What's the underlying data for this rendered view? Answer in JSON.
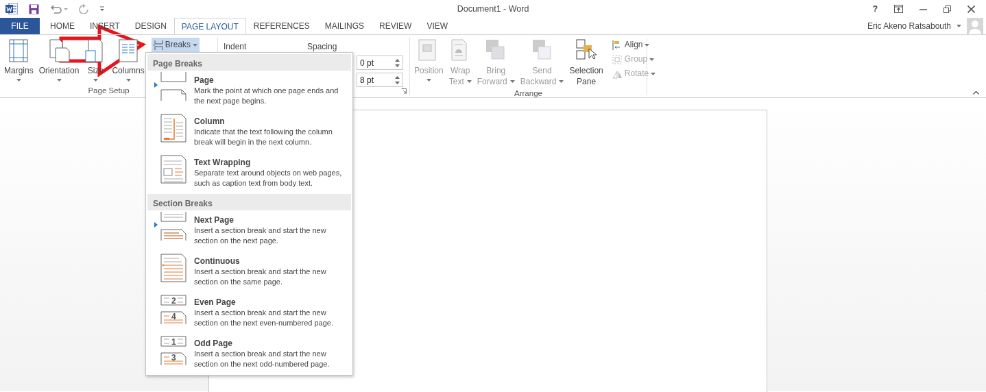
{
  "title_bar": {
    "title": "Document1 - Word",
    "help": "?"
  },
  "tabs": [
    {
      "label": "FILE",
      "kind": "file",
      "selected": false
    },
    {
      "label": "HOME",
      "kind": "tab",
      "selected": false
    },
    {
      "label": "INSERT",
      "kind": "tab",
      "selected": false
    },
    {
      "label": "DESIGN",
      "kind": "tab",
      "selected": false
    },
    {
      "label": "PAGE LAYOUT",
      "kind": "tab",
      "selected": true
    },
    {
      "label": "REFERENCES",
      "kind": "tab",
      "selected": false
    },
    {
      "label": "MAILINGS",
      "kind": "tab",
      "selected": false
    },
    {
      "label": "REVIEW",
      "kind": "tab",
      "selected": false
    },
    {
      "label": "VIEW",
      "kind": "tab",
      "selected": false
    }
  ],
  "user": {
    "name": "Eric Akeno Ratsabouth"
  },
  "page_setup": {
    "label": "Page Setup",
    "buttons": [
      {
        "label": "Margins",
        "kind": "margins"
      },
      {
        "label": "Orientation",
        "kind": "orientation"
      },
      {
        "label": "Size",
        "kind": "size"
      },
      {
        "label": "Columns",
        "kind": "columns"
      }
    ],
    "breaks": {
      "label": "Breaks",
      "expanded": true
    }
  },
  "paragraph": {
    "indent_label": "Indent",
    "spacing_label": "Spacing",
    "spacing_fields": [
      {
        "value": "0 pt"
      },
      {
        "value": "8 pt"
      }
    ]
  },
  "arrange": {
    "label": "Arrange",
    "large_buttons": [
      {
        "lines": [
          "Position"
        ],
        "kind": "position",
        "disabled": true,
        "dropdown": true
      },
      {
        "lines": [
          "Wrap",
          "Text"
        ],
        "kind": "wrap",
        "disabled": true,
        "dropdown": true
      },
      {
        "lines": [
          "Bring",
          "Forward"
        ],
        "kind": "bring",
        "disabled": true,
        "dropdown": true
      },
      {
        "lines": [
          "Send",
          "Backward"
        ],
        "kind": "send",
        "disabled": true,
        "dropdown": true
      },
      {
        "lines": [
          "Selection",
          "Pane"
        ],
        "kind": "selection",
        "disabled": false,
        "dropdown": false
      }
    ],
    "small_buttons": [
      {
        "label": "Align",
        "kind": "align",
        "disabled": false
      },
      {
        "label": "Group",
        "kind": "group",
        "disabled": true
      },
      {
        "label": "Rotate",
        "kind": "rotate",
        "disabled": true
      }
    ]
  },
  "breaks_menu": {
    "sections": [
      {
        "heading": "Page Breaks",
        "items": [
          {
            "title": "Page",
            "description": "Mark the point at which one page ends and the next page begins.",
            "kind": "page"
          },
          {
            "title": "Column",
            "description": "Indicate that the text following the column break will begin in the next column.",
            "kind": "column"
          },
          {
            "title": "Text Wrapping",
            "description": "Separate text around objects on web pages, such as caption text from body text.",
            "kind": "wrapping"
          }
        ]
      },
      {
        "heading": "Section Breaks",
        "items": [
          {
            "title": "Next Page",
            "description": "Insert a section break and start the new section on the next page.",
            "kind": "next"
          },
          {
            "title": "Continuous",
            "description": "Insert a section break and start the new section on the same page.",
            "kind": "continuous"
          },
          {
            "title": "Even Page",
            "description": "Insert a section break and start the new section on the next even-numbered page.",
            "kind": "numbered",
            "page_numbers": [
              "2",
              "4"
            ]
          },
          {
            "title": "Odd Page",
            "description": "Insert a section break and start the new section on the next odd-numbered page.",
            "kind": "numbered",
            "page_numbers": [
              "1",
              "3"
            ]
          }
        ]
      }
    ]
  }
}
